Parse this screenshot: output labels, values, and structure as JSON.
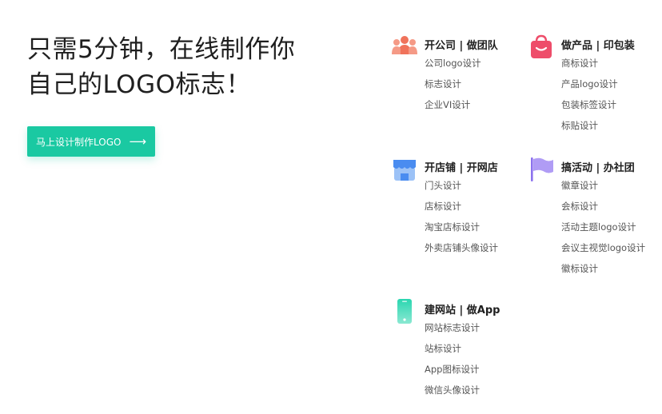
{
  "hero": {
    "title_line1": "只需5分钟，在线制作你",
    "title_line2": "自己的LOGO标志！",
    "cta_label": "马上设计制作LOGO",
    "cta_arrow": "⟶"
  },
  "colors": {
    "accent": "#1ac9a2",
    "company_icon": "#f0735b",
    "product_icon": "#ee4d6a",
    "shop_icon": "#4a8cf0",
    "event_icon": "#8c72ee",
    "website_icon": "#2ad6b0"
  },
  "categories": [
    {
      "heading": "开公司 | 做团队",
      "icon": "team-icon",
      "items": [
        "公司logo设计",
        "标志设计",
        "企业VI设计"
      ]
    },
    {
      "heading": "做产品 | 印包装",
      "icon": "shopping-bag-icon",
      "items": [
        "商标设计",
        "产品logo设计",
        "包装标签设计",
        "标贴设计"
      ]
    },
    {
      "heading": "开店铺 | 开网店",
      "icon": "storefront-icon",
      "items": [
        "门头设计",
        "店标设计",
        "淘宝店标设计",
        "外卖店铺头像设计"
      ]
    },
    {
      "heading": "搞活动 | 办社团",
      "icon": "flag-icon",
      "items": [
        "徽章设计",
        "会标设计",
        "活动主题logo设计",
        "会议主视觉logo设计",
        "徽标设计"
      ]
    },
    {
      "heading": "建网站 | 做App",
      "icon": "mobile-phone-icon",
      "items": [
        "网站标志设计",
        "站标设计",
        "App图标设计",
        "微信头像设计"
      ]
    }
  ]
}
